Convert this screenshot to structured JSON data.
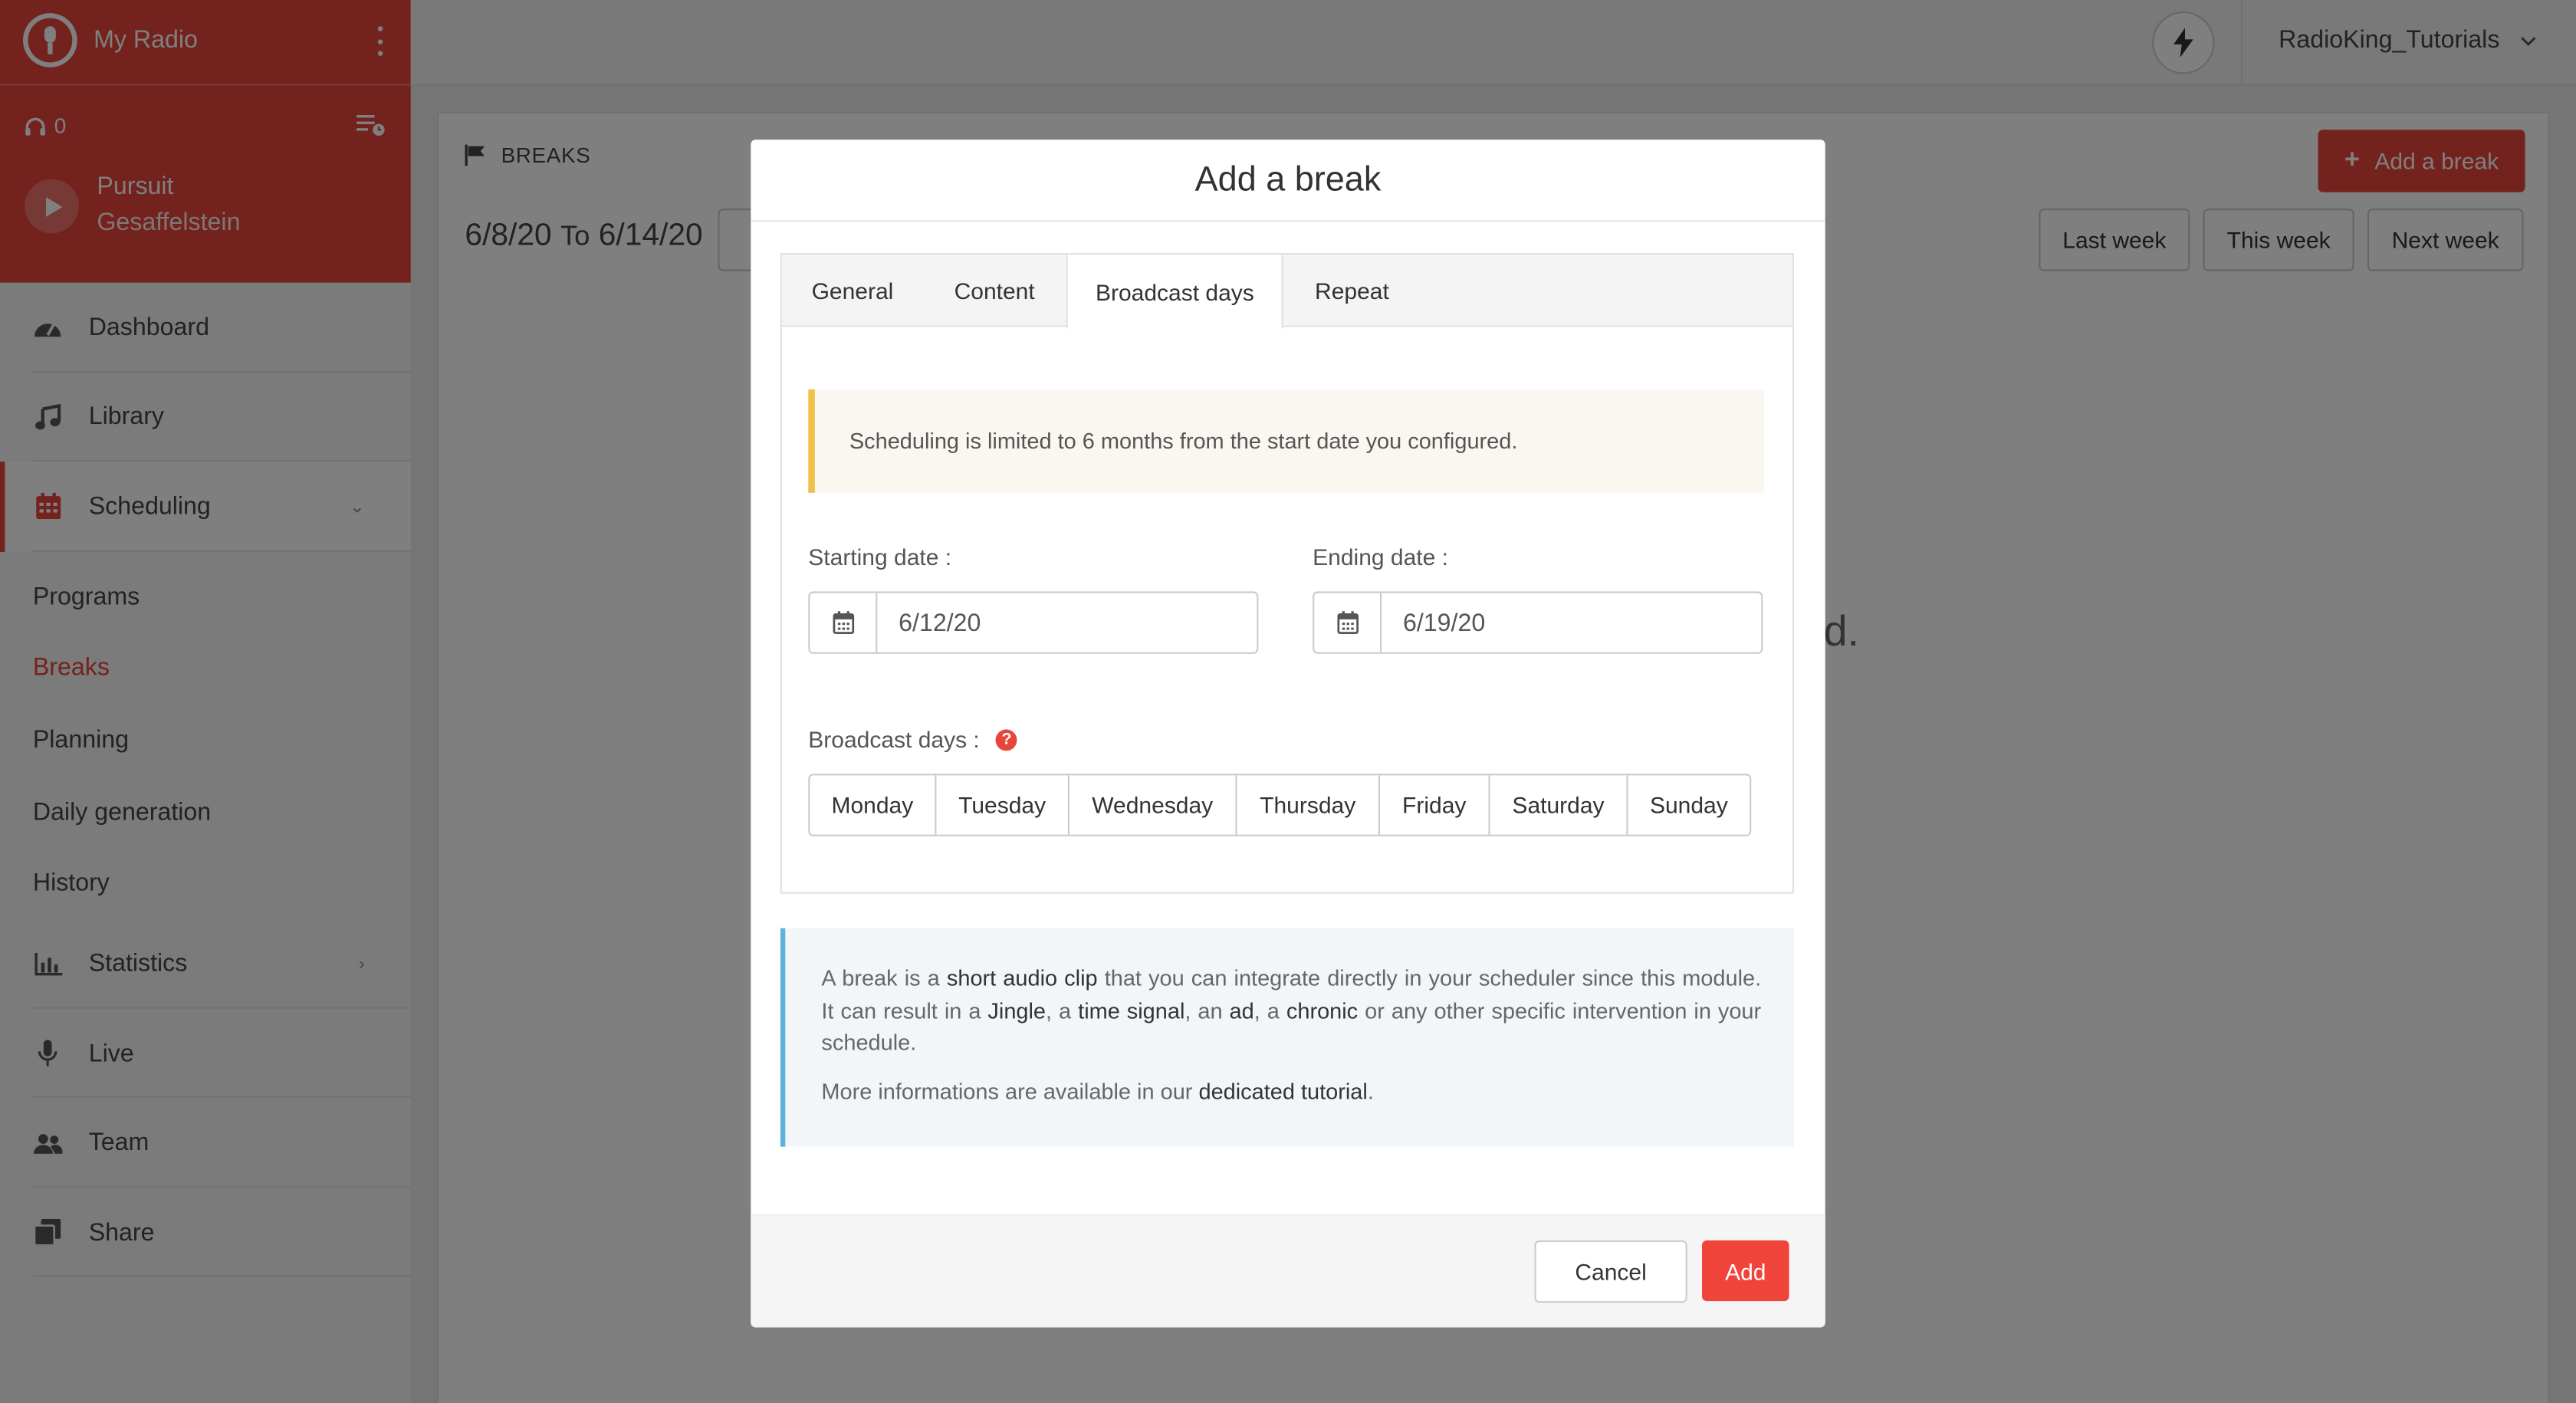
{
  "app": {
    "name": "My Radio"
  },
  "player": {
    "listeners": "0",
    "track_title": "Pursuit",
    "track_artist": "Gesaffelstein"
  },
  "sidebar": {
    "items": [
      {
        "label": "Dashboard",
        "icon": "dashboard-icon"
      },
      {
        "label": "Library",
        "icon": "music-note-icon"
      },
      {
        "label": "Scheduling",
        "icon": "calendar-icon",
        "expanded": true
      },
      {
        "label": "Statistics",
        "icon": "bar-chart-icon"
      },
      {
        "label": "Live",
        "icon": "microphone-icon"
      },
      {
        "label": "Team",
        "icon": "users-icon"
      },
      {
        "label": "Share",
        "icon": "share-icon"
      }
    ],
    "scheduling_sub": [
      "Programs",
      "Breaks",
      "Planning",
      "Daily generation",
      "History"
    ],
    "active_sub": "Breaks"
  },
  "topbar": {
    "username": "RadioKing_Tutorials"
  },
  "page": {
    "breadcrumb": "BREAKS",
    "range_from": "6/8/20",
    "range_sep": "To",
    "range_to": "6/14/20",
    "add_break_label": "Add a break",
    "week_buttons": [
      "Last week",
      "This week",
      "Next week"
    ],
    "background_text": "d."
  },
  "modal": {
    "title": "Add a break",
    "tabs": [
      "General",
      "Content",
      "Broadcast days",
      "Repeat"
    ],
    "active_tab": "Broadcast days",
    "warning": "Scheduling is limited to 6 months from the start date you configured.",
    "starting_label": "Starting date :",
    "starting_value": "6/12/20",
    "ending_label": "Ending date :",
    "ending_value": "6/19/20",
    "broadcast_days_label": "Broadcast days :",
    "days": [
      "Monday",
      "Tuesday",
      "Wednesday",
      "Thursday",
      "Friday",
      "Saturday",
      "Sunday"
    ],
    "info": {
      "p1_a": "A break is a ",
      "p1_b": "short audio clip",
      "p1_c": " that you can integrate directly in your scheduler since this module. It can result in a ",
      "p1_d": "Jingle",
      "p1_e": ", a ",
      "p1_f": "time signal",
      "p1_g": ", an ",
      "p1_h": "ad",
      "p1_i": ", a ",
      "p1_j": "chronic",
      "p1_k": " or any other specific intervention in your schedule.",
      "p2_a": "More informations are available in our ",
      "p2_link": "dedicated tutorial",
      "p2_b": "."
    },
    "cancel_label": "Cancel",
    "add_label": "Add"
  },
  "colors": {
    "accent": "#e8453c",
    "warning_border": "#f0c04a",
    "info_border": "#5fb3d9"
  }
}
